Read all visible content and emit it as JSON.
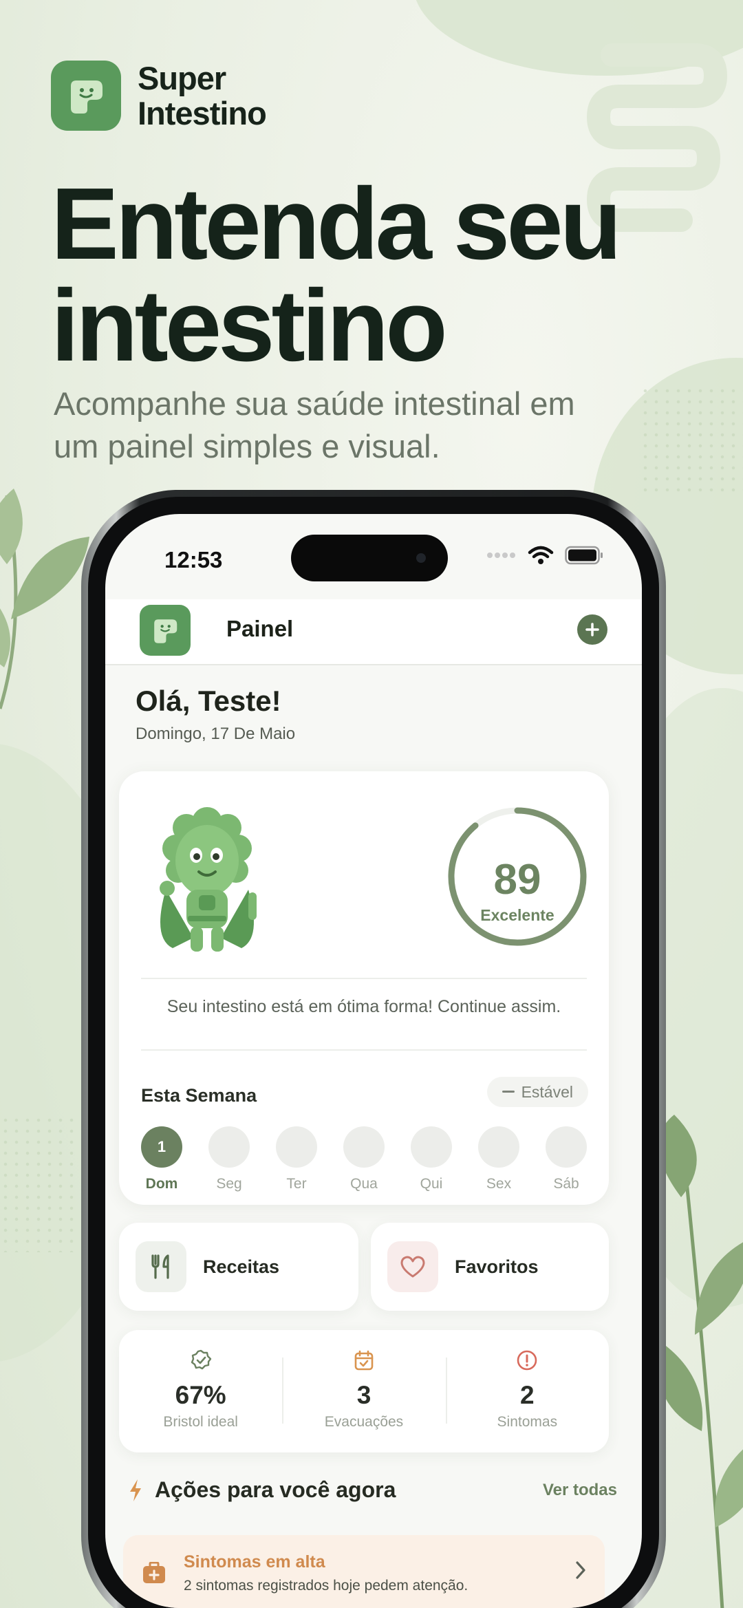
{
  "brand": {
    "name_line1": "Super",
    "name_line2": "Intestino"
  },
  "hero": {
    "title_line1": "Entenda seu",
    "title_line2": "intestino",
    "subtitle": "Acompanhe sua saúde intestinal em um painel simples e visual."
  },
  "status_bar": {
    "time": "12:53"
  },
  "header": {
    "title": "Painel",
    "add_icon": "plus-circle-icon"
  },
  "greeting": {
    "title": "Olá, Teste!",
    "date": "Domingo, 17 De Maio"
  },
  "score": {
    "value": "89",
    "fraction": 0.89,
    "label": "Excelente",
    "message": "Seu intestino está em ótima forma! Continue assim."
  },
  "week": {
    "title": "Esta Semana",
    "trend": "Estável",
    "days": [
      {
        "label": "Dom",
        "count": "1",
        "active": true
      },
      {
        "label": "Seg",
        "count": "",
        "active": false
      },
      {
        "label": "Ter",
        "count": "",
        "active": false
      },
      {
        "label": "Qua",
        "count": "",
        "active": false
      },
      {
        "label": "Qui",
        "count": "",
        "active": false
      },
      {
        "label": "Sex",
        "count": "",
        "active": false
      },
      {
        "label": "Sáb",
        "count": "",
        "active": false
      }
    ]
  },
  "quick_links": [
    {
      "label": "Receitas",
      "icon": "fork-knife-icon"
    },
    {
      "label": "Favoritos",
      "icon": "heart-icon"
    }
  ],
  "stats": [
    {
      "value": "67%",
      "label": "Bristol ideal",
      "icon": "check-badge-icon"
    },
    {
      "value": "3",
      "label": "Evacuações",
      "icon": "calendar-check-icon"
    },
    {
      "value": "2",
      "label": "Sintomas",
      "icon": "alert-circle-icon"
    }
  ],
  "actions": {
    "title": "Ações para você agora",
    "see_all": "Ver todas",
    "items": [
      {
        "title": "Sintomas em alta",
        "description": "2 sintomas registrados hoje pedem atenção.",
        "icon": "first-aid-kit-icon"
      }
    ]
  },
  "colors": {
    "primary": "#5a9a5c",
    "accent": "#6b8160",
    "warning": "#d08a4e",
    "heart": "#c97a70"
  }
}
